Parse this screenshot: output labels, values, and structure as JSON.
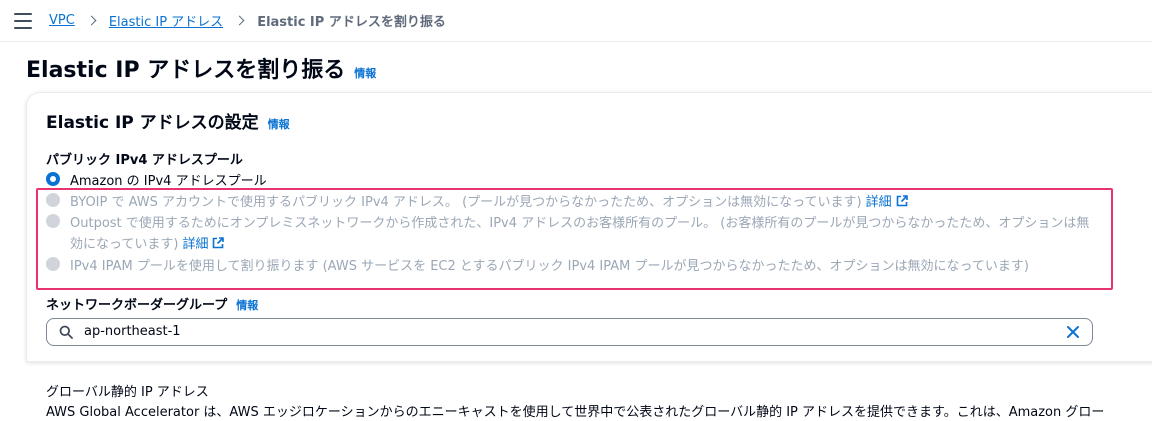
{
  "breadcrumb": {
    "items": [
      "VPC",
      "Elastic IP アドレス"
    ],
    "current": "Elastic IP アドレスを割り振る"
  },
  "page": {
    "title": "Elastic IP アドレスを割り振る",
    "info": "情報"
  },
  "panel": {
    "title": "Elastic IP アドレスの設定",
    "info": "情報"
  },
  "pool": {
    "label": "パブリック IPv4 アドレスプール",
    "options": [
      {
        "text": "Amazon の IPv4 アドレスプール",
        "selected": true,
        "disabled": false
      },
      {
        "text": "BYOIP で AWS アカウントで使用するパブリック IPv4 アドレス。 (プールが見つからなかったため、オプションは無効になっています)",
        "link": "詳細",
        "selected": false,
        "disabled": true
      },
      {
        "text": "Outpost で使用するためにオンプレミスネットワークから作成された、IPv4 アドレスのお客様所有のプール。 (お客様所有のプールが見つからなかったため、オプションは無効になっています)",
        "link": "詳細",
        "selected": false,
        "disabled": true
      },
      {
        "text": "IPv4 IPAM プールを使用して割り振ります (AWS サービスを EC2 とするパブリック IPv4 IPAM プールが見つからなかったため、オプションは無効になっています)",
        "selected": false,
        "disabled": true
      }
    ]
  },
  "border_group": {
    "label": "ネットワークボーダーグループ",
    "info": "情報",
    "value": "ap-northeast-1"
  },
  "global_ip": {
    "label": "グローバル静的 IP アドレス",
    "description": "AWS Global Accelerator は、AWS エッジロケーションからのエニーキャストを使用して世界中で公表されたグローバル静的 IP アドレスを提供できます。これは、Amazon グロー"
  },
  "colors": {
    "link": "#0972d3",
    "highlight": "#e8336e",
    "disabled": "#9ba7b6"
  }
}
